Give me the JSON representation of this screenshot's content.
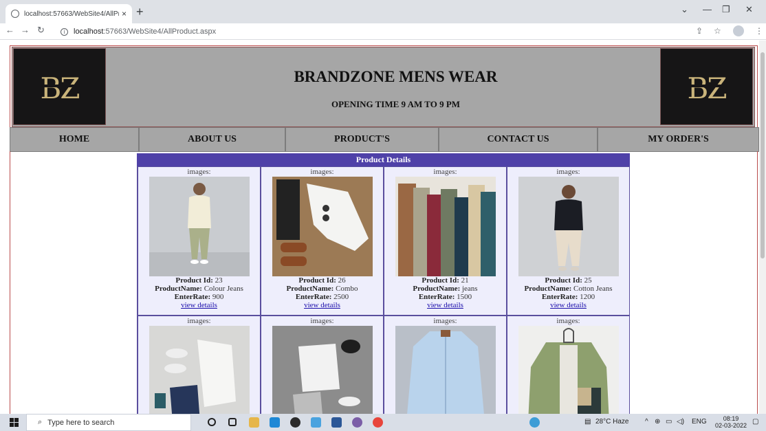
{
  "browser": {
    "tab_title": "localhost:57663/WebSite4/AllPro",
    "tab_close": "×",
    "new_tab": "+",
    "url_host": "localhost",
    "url_path": ":57663/WebSite4/AllProduct.aspx"
  },
  "site": {
    "logo_text": "BZ",
    "title": "BRANDZONE MENS WEAR",
    "subtitle": "OPENING TIME 9 AM TO 9 PM"
  },
  "menu": [
    {
      "label": "HOME"
    },
    {
      "label": "ABOUT US"
    },
    {
      "label": "PRODUCT'S"
    },
    {
      "label": "CONTACT US"
    },
    {
      "label": "MY ORDER'S"
    }
  ],
  "grid": {
    "header": "Product Details",
    "image_label": "images:",
    "id_label": "Product Id:",
    "name_label": "ProductName:",
    "rate_label": "EnterRate:",
    "link_label": "view details",
    "products": [
      {
        "id": "23",
        "name": "Colour Jeans",
        "rate": "900"
      },
      {
        "id": "26",
        "name": "Combo",
        "rate": "2500"
      },
      {
        "id": "21",
        "name": "jeans",
        "rate": "1500"
      },
      {
        "id": "25",
        "name": "Cotton Jeans",
        "rate": "1200"
      }
    ]
  },
  "taskbar": {
    "search_placeholder": "Type here to search",
    "weather": "28°C Haze",
    "language": "ENG",
    "time": "08:19",
    "date": "02-03-2022"
  }
}
